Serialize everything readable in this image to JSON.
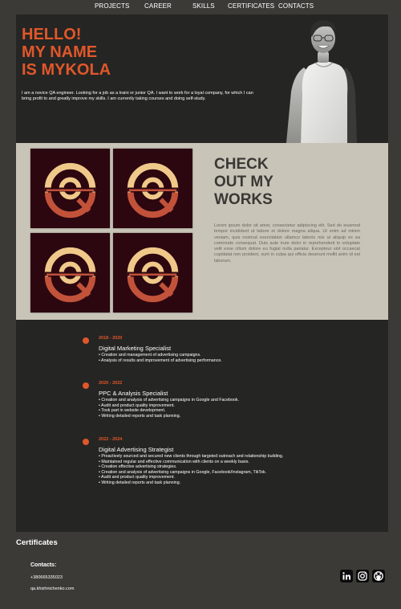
{
  "nav": {
    "items": [
      "PROJECTS",
      "CAREER",
      "SKILLS",
      "CERTIFICATES",
      "CONTACTS"
    ]
  },
  "hero": {
    "title_lines": [
      "HELLO!",
      "MY NAME",
      "IS MYKOLA"
    ],
    "intro": "I am a novice QA engineer. Looking for a job as a traini or junior QA. I want to work for a loyal company, for which I can bring profit to and greatly improve my skills. I am currently taking courses and doing self-study."
  },
  "works": {
    "title_lines": [
      "CHECK",
      "OUT MY",
      "WORKS"
    ],
    "text": "Lorem ipsum dolor sit amet, consectetur adipiscing elit. Sed do eiusmod tempor incididunt ut labore et dolore magna aliqua. Ut enim ad minim veniam, quis nostrud exercitation ullamco laboris nisi ut aliquip ex ea commodo consequat. Duis aute irure dolor in reprehenderit in voluptate velit esse cillum dolore eu fugiat nulla pariatur. Excepteur sint occaecat cupidatat non proident, sunt in culpa qui officia deserunt mollit anim id est laborum.",
    "tile_icon": "qa-logo-icon"
  },
  "career": {
    "entries": [
      {
        "date": "2018 - 2020",
        "role": "Digital Marketing Specialist",
        "points": [
          "• Creation and management of advertising campaigns.",
          "• Analysis of results and improvement of advertising performance."
        ]
      },
      {
        "date": "2020 - 2022",
        "role": "PPC & Analysis Specialist",
        "points": [
          "• Creation and analysis of advertising campaigns in Google and Facebook.",
          "• Audit and product quality improvement.",
          "• Took part in website development.",
          "• Writing detailed reports and task planning."
        ]
      },
      {
        "date": "2022 - 2024",
        "role": "Digital Advertising Strategist",
        "points": [
          "• Proactively sourced and secured new clients through targeted outreach and relationship building.",
          "• Maintained regular and effective communication with clients on a weekly basis.",
          "• Creation effective advertising strategies.",
          "• Creation and analysis of advertising campaigns in Google, Facebook/Instagram, TikTok.",
          "• Audit and product quality improvement.",
          "• Writing detailed reports and task planning."
        ]
      }
    ]
  },
  "footer": {
    "certificates": "Certificates",
    "contacts_label": "Contacts:",
    "phone": "+380665335023",
    "email": "qa.khizhnichenko.com",
    "social_icons": [
      "linkedin-icon",
      "instagram-icon",
      "github-icon"
    ]
  },
  "colors": {
    "accent": "#e0572a",
    "dark_panel": "#252523",
    "page_bg": "#3c3a36",
    "works_bg": "#c9c4b8",
    "tile_bg": "#2c0710"
  }
}
